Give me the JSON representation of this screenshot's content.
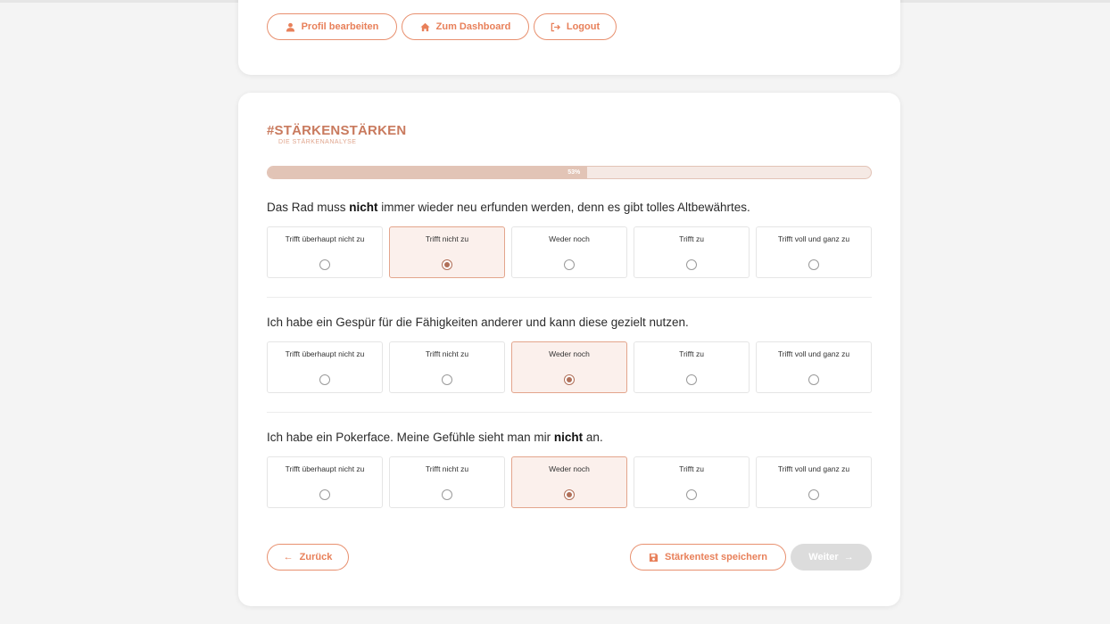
{
  "profile_nav": {
    "edit_profile": "Profil bearbeiten",
    "dashboard": "Zum Dashboard",
    "logout": "Logout"
  },
  "brand": {
    "title": "#STÄRKENSTÄRKEN",
    "subtitle": "DIE STÄRKENANALYSE"
  },
  "progress": {
    "percent": 53,
    "label": "53%"
  },
  "option_labels": [
    "Trifft überhaupt nicht zu",
    "Trifft nicht zu",
    "Weder noch",
    "Trifft zu",
    "Trifft voll und ganz zu"
  ],
  "questions": [
    {
      "text_before": "Das Rad muss ",
      "emphasis": "nicht",
      "text_after": " immer wieder neu erfunden werden, denn es gibt tolles Altbewährtes.",
      "selected_index": 1
    },
    {
      "text_before": "Ich habe ein Gespür für die Fähigkeiten anderer und kann diese gezielt nutzen.",
      "emphasis": "",
      "text_after": "",
      "selected_index": 2
    },
    {
      "text_before": "Ich habe ein Pokerface. Meine Gefühle sieht man mir ",
      "emphasis": "nicht",
      "text_after": " an.",
      "selected_index": 2
    }
  ],
  "footer": {
    "back": "Zurück",
    "save": "Stärkentest speichern",
    "next": "Weiter"
  },
  "colors": {
    "accent": "#e8805a",
    "selected_bg": "#fbf0ec",
    "progress_fill": "#e2c4b6",
    "disabled": "#dcdcdc"
  }
}
